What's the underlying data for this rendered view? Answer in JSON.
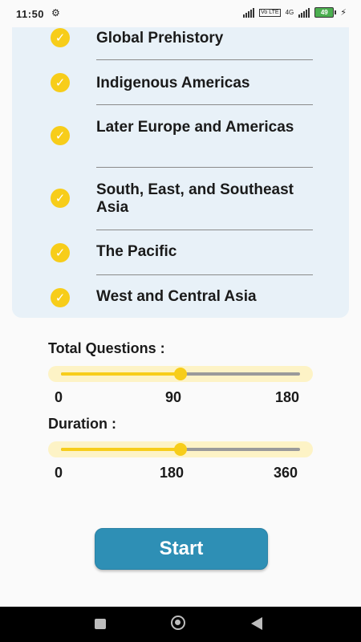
{
  "status_bar": {
    "time": "11:50",
    "network": "4G",
    "volte": "Vo LTE",
    "battery": "49"
  },
  "topics": [
    {
      "label": "Global Prehistory",
      "checked": true
    },
    {
      "label": "Indigenous Americas",
      "checked": true
    },
    {
      "label": "Later Europe and Americas",
      "checked": true
    },
    {
      "label": "South, East, and Southeast Asia",
      "checked": true
    },
    {
      "label": "The Pacific",
      "checked": true
    },
    {
      "label": "West and Central Asia",
      "checked": true
    }
  ],
  "total_questions": {
    "label": "Total Questions :",
    "min": "0",
    "mid": "90",
    "max": "180",
    "value": 90
  },
  "duration": {
    "label": "Duration :",
    "min": "0",
    "mid": "180",
    "max": "360",
    "value": 180
  },
  "start_label": "Start",
  "colors": {
    "accent_yellow": "#f7cd1a",
    "card_bg": "#e8f1f8",
    "button_blue": "#2e8fb5"
  }
}
